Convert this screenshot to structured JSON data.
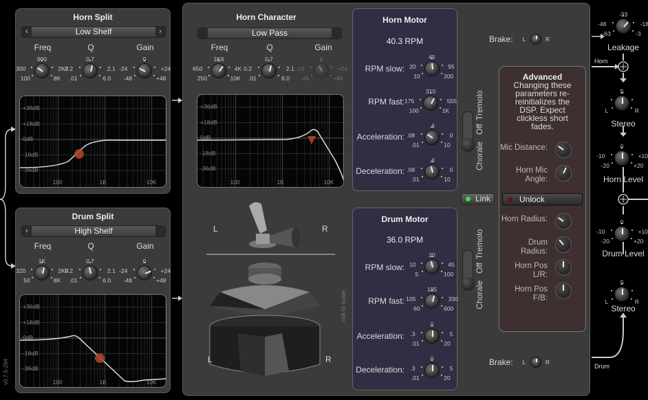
{
  "version": "v0.7.5-294",
  "horn_split": {
    "title": "Horn Split",
    "filter": "Low Shelf",
    "freq_label": "Freq",
    "q_label": "Q",
    "gain_label": "Gain",
    "freq": {
      "labels": [
        "100",
        "300",
        "900",
        "2K7",
        "8K"
      ],
      "value": 0.3
    },
    "q": {
      "labels": [
        ".01",
        "0.2",
        "0.7",
        "2.1",
        "6.0"
      ],
      "value": 0.55
    },
    "gain": {
      "labels": [
        "-48",
        "-24",
        "0",
        "+24",
        "+48"
      ],
      "value": 0.27
    },
    "graph": {
      "y_labels": [
        "+36dB",
        "+18dB",
        "0dB",
        "-18dB",
        "-36dB"
      ],
      "x_labels": [
        "100",
        "1K",
        "10K"
      ]
    }
  },
  "drum_split": {
    "title": "Drum Split",
    "filter": "High Shelf",
    "freq_label": "Freq",
    "q_label": "Q",
    "gain_label": "Gain",
    "freq": {
      "labels": [
        "50",
        "320",
        "1K",
        "2K9",
        "8K"
      ],
      "value": 0.55
    },
    "q": {
      "labels": [
        ".01",
        "0.2",
        "0.7",
        "2.1",
        "6.0"
      ],
      "value": 0.45
    },
    "gain": {
      "labels": [
        "-48",
        "-24",
        "0",
        "+24",
        "+48"
      ],
      "value": 0.75
    },
    "graph": {
      "y_labels": [
        "+36dB",
        "+18dB",
        "0dB",
        "-18dB",
        "-36dB"
      ],
      "x_labels": [
        "100",
        "1K",
        "10K"
      ]
    }
  },
  "horn_character": {
    "title": "Horn Character",
    "filter": "Low Pass",
    "freq_label": "Freq",
    "q_label": "Q",
    "gain_label": "Gain",
    "freq": {
      "labels": [
        "250",
        "650",
        "1K6",
        "4K",
        "10K"
      ],
      "value": 0.62
    },
    "q": {
      "labels": [
        ".01",
        "0.2",
        "0.7",
        "2.1",
        "6.0"
      ],
      "value": 0.55
    },
    "gain": {
      "labels": [
        "-48",
        "-24",
        "0",
        "+24",
        "+48"
      ],
      "value": 0.4
    },
    "graph": {
      "y_labels": [
        "+36dB",
        "+18dB",
        "0dB",
        "-18dB",
        "-36dB"
      ],
      "x_labels": [
        "100",
        "1K",
        "10K"
      ]
    }
  },
  "speaker": {
    "top_left": "L",
    "top_right": "R",
    "bottom_left": "L",
    "bottom_right": "R",
    "note": "not to scale"
  },
  "horn_motor": {
    "title": "Horn Motor",
    "rpm": "40.3 RPM",
    "rpm_slow": {
      "label": "RPM slow:",
      "labels": [
        "10",
        "20",
        "45",
        "95",
        "200"
      ],
      "value": 0.48
    },
    "rpm_fast": {
      "label": "RPM fast:",
      "labels": [
        "100",
        "175",
        "310",
        "555",
        "1K"
      ],
      "value": 0.6
    },
    "acceleration": {
      "label": "Acceleration:",
      "labels": [
        ".01",
        ".08",
        ".4",
        "0",
        "10"
      ],
      "value": 0.3
    },
    "deceleration": {
      "label": "Deceleration:",
      "labels": [
        ".01",
        ".08",
        ".4",
        "0",
        "10"
      ],
      "value": 0.45
    }
  },
  "drum_motor": {
    "title": "Drum Motor",
    "rpm": "36.0 RPM",
    "rpm_slow": {
      "label": "RPM slow:",
      "labels": [
        "5",
        "10",
        "20",
        "45",
        "100"
      ],
      "value": 0.45
    },
    "rpm_fast": {
      "label": "RPM fast:",
      "labels": [
        "60",
        "105",
        "185",
        "330",
        "600"
      ],
      "value": 0.55
    },
    "acceleration": {
      "label": "Acceleration:",
      "labels": [
        ".01",
        ".3",
        "0",
        "5",
        "20"
      ],
      "value": 0.5
    },
    "deceleration": {
      "label": "Deceleration:",
      "labels": [
        ".01",
        ".3",
        "0",
        "5",
        "20"
      ],
      "value": 0.5
    }
  },
  "speed_switch": {
    "chorale": "Chorale",
    "off": "Off",
    "tremolo": "Tremolo",
    "horn_state": "Chorale",
    "drum_state": "Chorale"
  },
  "brake": {
    "label": "Brake:",
    "l": "L",
    "r": "R"
  },
  "link": {
    "label": "Link",
    "active": true
  },
  "advanced": {
    "title": "Advanced",
    "note": "Changing these parameters re-reinitializes the DSP. Expect clickless short fades.",
    "mic_distance": "Mic Distance:",
    "horn_mic_angle": "Horn Mic Angle:",
    "unlock": "Unlock",
    "horn_radius": "Horn Radius:",
    "drum_radius": "Drum Radius:",
    "horn_pos_lr": "Horn Pos L/R:",
    "horn_pos_fb": "Horn Pos F/B:"
  },
  "mixer": {
    "leakage": {
      "label": "Leakage",
      "labels": [
        "-63",
        "-48",
        "-33",
        "-18",
        "-3"
      ],
      "value": 0.65
    },
    "horn_in": "Horn",
    "drum_in": "Drum",
    "horn_stereo": {
      "label": "Stereo",
      "labels": [
        "L",
        "",
        "S",
        "",
        "R"
      ],
      "value": 0.5
    },
    "horn_level": {
      "label": "Horn Level",
      "labels": [
        "-20",
        "-10",
        "0",
        "+10",
        "+20"
      ],
      "value": 0.5
    },
    "drum_level": {
      "label": "Drum Level",
      "labels": [
        "-20",
        "-10",
        "0",
        "+10",
        "+20"
      ],
      "value": 0.5
    },
    "drum_stereo": {
      "label": "Stereo",
      "labels": [
        "L",
        "",
        "S",
        "",
        "R"
      ],
      "value": 0.5
    }
  },
  "colors": {
    "background": "#000000",
    "panel": "#3b3b3b",
    "motor_panel": "#2f2e42",
    "advanced_panel": "#3e3030",
    "marker": "#b0452a",
    "link_led": "#3adf3a"
  }
}
